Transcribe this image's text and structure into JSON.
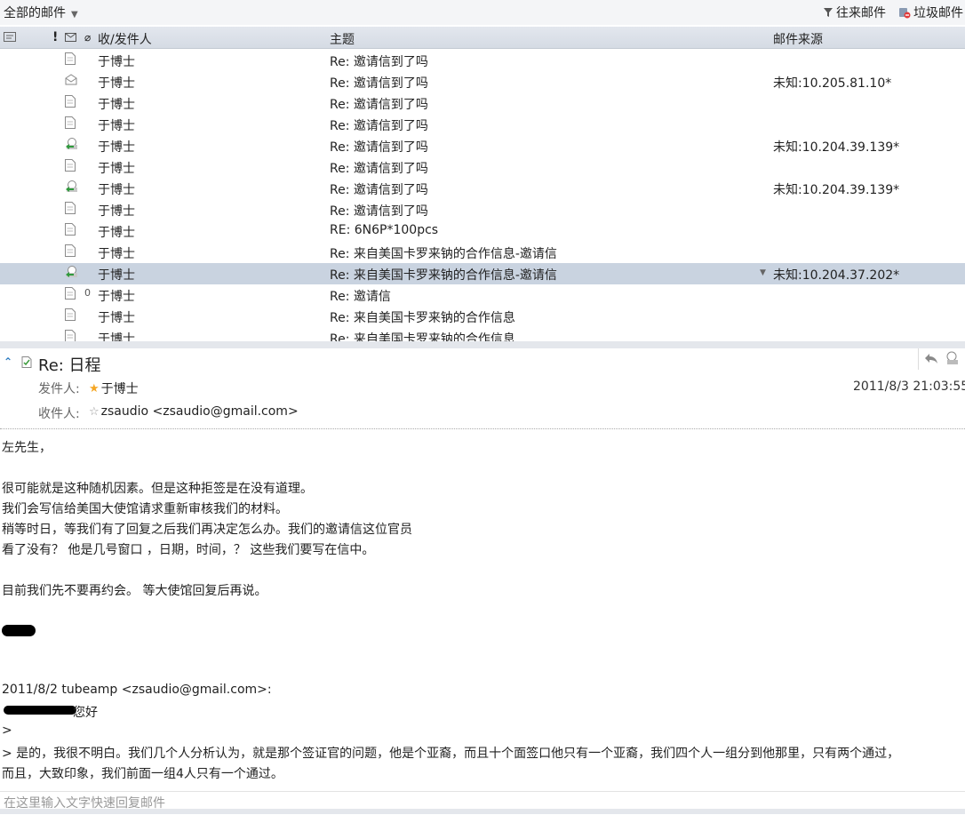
{
  "toolbar": {
    "folder": "全部的邮件",
    "contacts": "往来邮件",
    "spam": "垃圾邮件"
  },
  "list_header": {
    "sender": "收/发件人",
    "subject": "主题",
    "source": "邮件来源"
  },
  "rows": [
    {
      "sender": "于博士",
      "subject": "Re: 邀请信到了吗",
      "source": "",
      "icon": "doc-icon"
    },
    {
      "sender": "于博士",
      "subject": "Re: 邀请信到了吗",
      "source": "未知:10.205.81.10*",
      "icon": "envelope-open-icon"
    },
    {
      "sender": "于博士",
      "subject": "Re: 邀请信到了吗",
      "source": "",
      "icon": "doc-icon"
    },
    {
      "sender": "于博士",
      "subject": "Re: 邀请信到了吗",
      "source": "",
      "icon": "doc-icon"
    },
    {
      "sender": "于博士",
      "subject": "Re: 邀请信到了吗",
      "source": "未知:10.204.39.139*",
      "icon": "replied-icon"
    },
    {
      "sender": "于博士",
      "subject": "Re: 邀请信到了吗",
      "source": "",
      "icon": "doc-icon"
    },
    {
      "sender": "于博士",
      "subject": "Re: 邀请信到了吗",
      "source": "未知:10.204.39.139*",
      "icon": "replied-icon"
    },
    {
      "sender": "于博士",
      "subject": "Re: 邀请信到了吗",
      "source": "",
      "icon": "doc-icon"
    },
    {
      "sender": "于博士",
      "subject": "RE: 6N6P*100pcs",
      "source": "",
      "icon": "doc-icon"
    },
    {
      "sender": "于博士",
      "subject": "Re: 来自美国卡罗来钠的合作信息-邀请信",
      "source": "",
      "icon": "doc-icon"
    },
    {
      "sender": "于博士",
      "subject": "Re: 来自美国卡罗来钠的合作信息-邀请信",
      "source": "未知:10.204.37.202*",
      "icon": "replied-icon"
    },
    {
      "sender": "于博士",
      "subject": "Re: 邀请信",
      "source": "",
      "icon": "doc-icon"
    },
    {
      "sender": "于博士",
      "subject": "Re: 来自美国卡罗来钠的合作信息",
      "source": "",
      "icon": "doc-icon"
    },
    {
      "sender": "于博士",
      "subject": "Re: 来自美国卡罗来钠的合作信息",
      "source": "",
      "icon": "doc-icon"
    }
  ],
  "message": {
    "title": "Re: 日程",
    "from_label": "发件人:",
    "from": "于博士",
    "to_label": "收件人:",
    "to": "zsaudio <zsaudio@gmail.com>",
    "date": "2011/8/3 21:03:55",
    "body": [
      "左先生，",
      "很可能就是这种随机因素。但是这种拒签是在没有道理。",
      "我们会写信给美国大使馆请求重新审核我们的材料。",
      "稍等时日，等我们有了回复之后我们再决定怎么办。我们的邀请信这位官员",
      "看了没有？ 他是几号窗口 ，日期，时间，？ 这些我们要写在信中。",
      "目前我们先不要再约会。 等大使馆回复后再说。",
      "2011/8/2 tubeamp <zsaudio@gmail.com>:",
      "您好",
      ">",
      "> 是的，我很不明白。我们几个人分析认为，就是那个签证官的问题，他是个亚裔，而且十个面签口他只有一个亚裔，我们四个人一组分到他那里，只有两个通过，",
      "而且，大致印象，我们前面一组4人只有一个通过。"
    ]
  },
  "quick_reply": {
    "placeholder": "在这里输入文字快速回复邮件"
  }
}
